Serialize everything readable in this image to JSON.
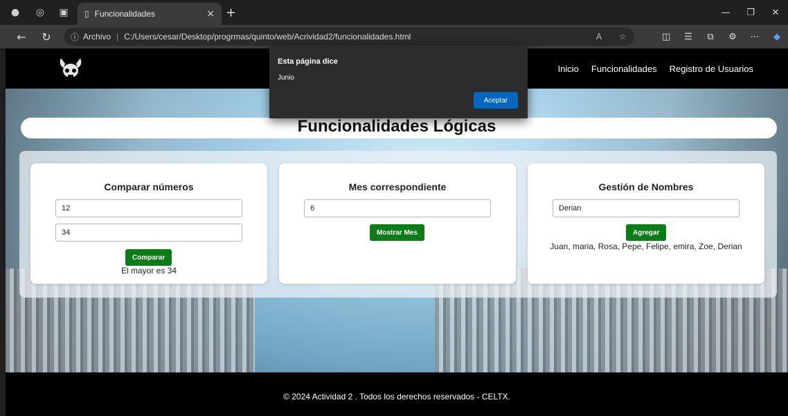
{
  "browser": {
    "tab_title": "Funcionalidades",
    "address_scheme": "Archivo",
    "address_url": "C:/Users/cesar/Desktop/progrmas/quinto/web/Acrividad2/funcionalidades.html"
  },
  "site": {
    "nav": [
      "Inicio",
      "Funcionalidades",
      "Registro de Usuarios"
    ],
    "page_title": "Funcionalidades Lógicas",
    "footer_text": "© 2024 Actividad 2 . Todos los derechos reservados - CELTX."
  },
  "cards": {
    "compare": {
      "title": "Comparar números",
      "input1": "12",
      "input2": "34",
      "button": "Comparar",
      "result": "El mayor es 34"
    },
    "month": {
      "title": "Mes correspondiente",
      "input": "6",
      "button": "Mostrar Mes"
    },
    "names": {
      "title": "Gestión de Nombres",
      "input": "Derian",
      "button": "Agregar",
      "result": "Juan, maria, Rosa, Pepe, Felipe, emira, Zoe, Derian"
    }
  },
  "dialog": {
    "title": "Esta página dice",
    "message": "Junio",
    "ok_label": "Aceptar"
  },
  "colors": {
    "button_green": "#0a7d16",
    "dialog_accent": "#0067c0",
    "header_bg": "#000000"
  }
}
